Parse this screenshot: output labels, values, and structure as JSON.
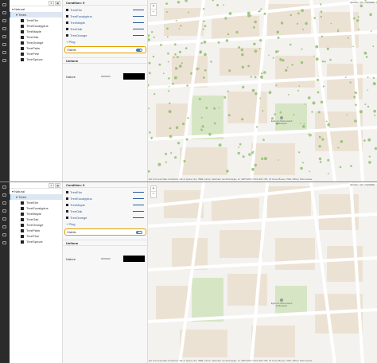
{
  "panels": [
    {
      "search_label": "",
      "tree": {
        "root": "Natural",
        "group": "Trees",
        "items": [
          "TreeElm",
          "TreeEucalyptus",
          "TreeMaple",
          "TreeOak",
          "TreeOrange",
          "TreePalm",
          "TreePine",
          "TreeSpruce"
        ]
      },
      "props": {
        "header": "Condition: 9",
        "items": [
          "TreeElm",
          "TreeEucalyptus",
          "TreeMaple",
          "TreeOak",
          "TreeOrange"
        ],
        "more": "+ Plug",
        "visible_label": "Visible",
        "visible_on": true,
        "section": "Uniform",
        "field_label": "Nature",
        "field_value": "#000000"
      },
      "map": {
        "location": "Québec, QC, CANADA",
        "attribution": "Esri Community Maps Contributors, Ville de Québec, Esri, HERE, Garmin, SafeGraph, GeoTechnologies, Inc, METI/NASA, USGS, EPA, NPS, US Census Bureau, USDA, NRCan, Parks Canada",
        "poi": "Église de Saint-Joseph de Beauport",
        "zoom_in": "+",
        "zoom_out": "−",
        "show_trees": true
      }
    },
    {
      "search_label": "",
      "tree": {
        "root": "Natural",
        "group": "Trees",
        "items": [
          "TreeElm",
          "TreeEucalyptus",
          "TreeMaple",
          "TreeOak",
          "TreeOrange",
          "TreePalm",
          "TreePine",
          "TreeSpruce"
        ]
      },
      "props": {
        "header": "Condition: 9",
        "items": [
          "TreeElm",
          "TreeEucalyptus",
          "TreeMaple",
          "TreeOak",
          "TreeOrange"
        ],
        "more": "+ Plug",
        "visible_label": "Visible",
        "visible_on": false,
        "section": "Uniform",
        "field_label": "Nature",
        "field_value": "#000000"
      },
      "map": {
        "location": "Québec, QC, CANADA",
        "attribution": "Esri Community Maps Contributors, Ville de Québec, Esri, HERE, Garmin, SafeGraph, GeoTechnologies, Inc, METI/NASA, USGS, EPA, NPS, US Census Bureau, USDA, NRCan, Parks Canada",
        "poi": "Église de Saint-Joseph de Beauport",
        "zoom_in": "+",
        "zoom_out": "−",
        "show_trees": false
      }
    }
  ],
  "colors": {
    "accent": "#1e78c6",
    "highlight": "#e2a100",
    "rail": "#2b2b2b",
    "park": "#d6e6c5",
    "building": "#e8dcc9",
    "road": "#ffffff",
    "tree": "#8fbf6a"
  }
}
